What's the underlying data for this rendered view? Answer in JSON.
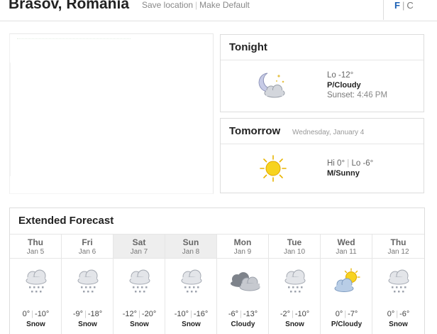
{
  "header": {
    "city": "Brasov, Romania",
    "save_location": "Save location",
    "make_default": "Make Default",
    "unit_f": "F",
    "unit_c": "C"
  },
  "tonight": {
    "title": "Tonight",
    "temp": "Lo -12°",
    "condition": "P/Cloudy",
    "sunset_label": "Sunset:",
    "sunset_time": "4:46 PM",
    "icon": "moon-cloud-icon"
  },
  "tomorrow": {
    "title": "Tomorrow",
    "date": "Wednesday, January 4",
    "hi": "Hi 0°",
    "lo": "Lo -6°",
    "condition": "M/Sunny",
    "icon": "sun-icon"
  },
  "extended": {
    "title": "Extended Forecast",
    "days": [
      {
        "name": "Thu",
        "date": "Jan 5",
        "hi": "0°",
        "lo": "-10°",
        "cond": "Snow",
        "icon": "snow-icon"
      },
      {
        "name": "Fri",
        "date": "Jan 6",
        "hi": "-9°",
        "lo": "-18°",
        "cond": "Snow",
        "icon": "snow-icon"
      },
      {
        "name": "Sat",
        "date": "Jan 7",
        "hi": "-12°",
        "lo": "-20°",
        "cond": "Snow",
        "icon": "snow-icon"
      },
      {
        "name": "Sun",
        "date": "Jan 8",
        "hi": "-10°",
        "lo": "-16°",
        "cond": "Snow",
        "icon": "snow-icon"
      },
      {
        "name": "Mon",
        "date": "Jan 9",
        "hi": "-6°",
        "lo": "-13°",
        "cond": "Cloudy",
        "icon": "cloudy-icon"
      },
      {
        "name": "Tue",
        "date": "Jan 10",
        "hi": "-2°",
        "lo": "-10°",
        "cond": "Snow",
        "icon": "snow-icon"
      },
      {
        "name": "Wed",
        "date": "Jan 11",
        "hi": "0°",
        "lo": "-7°",
        "cond": "P/Cloudy",
        "icon": "partly-cloudy-icon"
      },
      {
        "name": "Thu",
        "date": "Jan 12",
        "hi": "0°",
        "lo": "-6°",
        "cond": "Snow",
        "icon": "snow-icon"
      }
    ]
  },
  "colors": {
    "link": "#1a5fb4",
    "weekend_shade": "#eeeeee",
    "sun": "#f7d31f",
    "cloud": "#c8ccd4",
    "moon": "#c7cbe6"
  }
}
